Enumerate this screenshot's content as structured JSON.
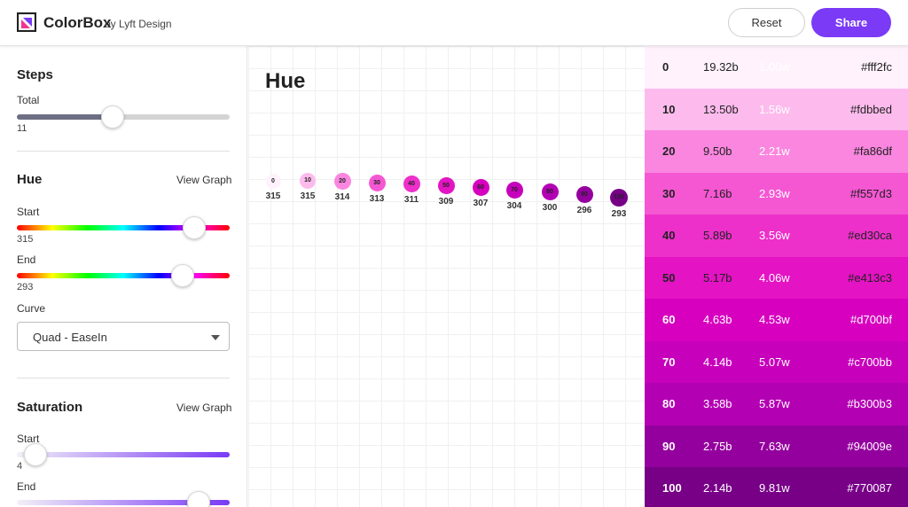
{
  "header": {
    "brand": "ColorBox",
    "byline": "by Lyft Design",
    "reset_label": "Reset",
    "share_label": "Share",
    "accent": "#7a3af6"
  },
  "sidebar": {
    "steps": {
      "title": "Steps",
      "total_label": "Total",
      "total_value": "11"
    },
    "hue": {
      "title": "Hue",
      "view_graph": "View Graph",
      "start_label": "Start",
      "start_value": "315",
      "end_label": "End",
      "end_value": "293",
      "curve_label": "Curve",
      "curve_value": "Quad - EaseIn"
    },
    "saturation": {
      "title": "Saturation",
      "view_graph": "View Graph",
      "start_label": "Start",
      "start_value": "4",
      "end_label": "End"
    }
  },
  "main": {
    "title": "Hue",
    "points": [
      {
        "step": "0",
        "hue": "315",
        "color": "#fff2fc"
      },
      {
        "step": "10",
        "hue": "315",
        "color": "#fdbbed"
      },
      {
        "step": "20",
        "hue": "314",
        "color": "#fa86df"
      },
      {
        "step": "30",
        "hue": "313",
        "color": "#f557d3"
      },
      {
        "step": "40",
        "hue": "311",
        "color": "#ed30ca"
      },
      {
        "step": "50",
        "hue": "309",
        "color": "#e413c3"
      },
      {
        "step": "60",
        "hue": "307",
        "color": "#d700bf"
      },
      {
        "step": "70",
        "hue": "304",
        "color": "#c700bb"
      },
      {
        "step": "80",
        "hue": "300",
        "color": "#b300b3"
      },
      {
        "step": "90",
        "hue": "296",
        "color": "#94009e"
      },
      {
        "step": "100",
        "hue": "293",
        "color": "#770087"
      }
    ]
  },
  "swatches": [
    {
      "step": "0",
      "b": "19.32b",
      "w": "1.00w",
      "hex": "#fff2fc",
      "bg": "#fff2fc",
      "fg": "#222",
      "wfg": "#ffffff"
    },
    {
      "step": "10",
      "b": "13.50b",
      "w": "1.56w",
      "hex": "#fdbbed",
      "bg": "#fdbbed",
      "fg": "#222",
      "wfg": "#ffffff"
    },
    {
      "step": "20",
      "b": "9.50b",
      "w": "2.21w",
      "hex": "#fa86df",
      "bg": "#fa86df",
      "fg": "#222",
      "wfg": "#ffffff"
    },
    {
      "step": "30",
      "b": "7.16b",
      "w": "2.93w",
      "hex": "#f557d3",
      "bg": "#f557d3",
      "fg": "#222",
      "wfg": "#ffffff"
    },
    {
      "step": "40",
      "b": "5.89b",
      "w": "3.56w",
      "hex": "#ed30ca",
      "bg": "#ed30ca",
      "fg": "#222",
      "wfg": "#ffffff"
    },
    {
      "step": "50",
      "b": "5.17b",
      "w": "4.06w",
      "hex": "#e413c3",
      "bg": "#e413c3",
      "fg": "#222",
      "wfg": "#ffffff"
    },
    {
      "step": "60",
      "b": "4.63b",
      "w": "4.53w",
      "hex": "#d700bf",
      "bg": "#d700bf",
      "fg": "#ffffff",
      "wfg": "#ffffff"
    },
    {
      "step": "70",
      "b": "4.14b",
      "w": "5.07w",
      "hex": "#c700bb",
      "bg": "#c700bb",
      "fg": "#ffffff",
      "wfg": "#ffffff"
    },
    {
      "step": "80",
      "b": "3.58b",
      "w": "5.87w",
      "hex": "#b300b3",
      "bg": "#b300b3",
      "fg": "#ffffff",
      "wfg": "#ffffff"
    },
    {
      "step": "90",
      "b": "2.75b",
      "w": "7.63w",
      "hex": "#94009e",
      "bg": "#94009e",
      "fg": "#ffffff",
      "wfg": "#ffffff"
    },
    {
      "step": "100",
      "b": "2.14b",
      "w": "9.81w",
      "hex": "#770087",
      "bg": "#770087",
      "fg": "#ffffff",
      "wfg": "#ffffff"
    }
  ]
}
